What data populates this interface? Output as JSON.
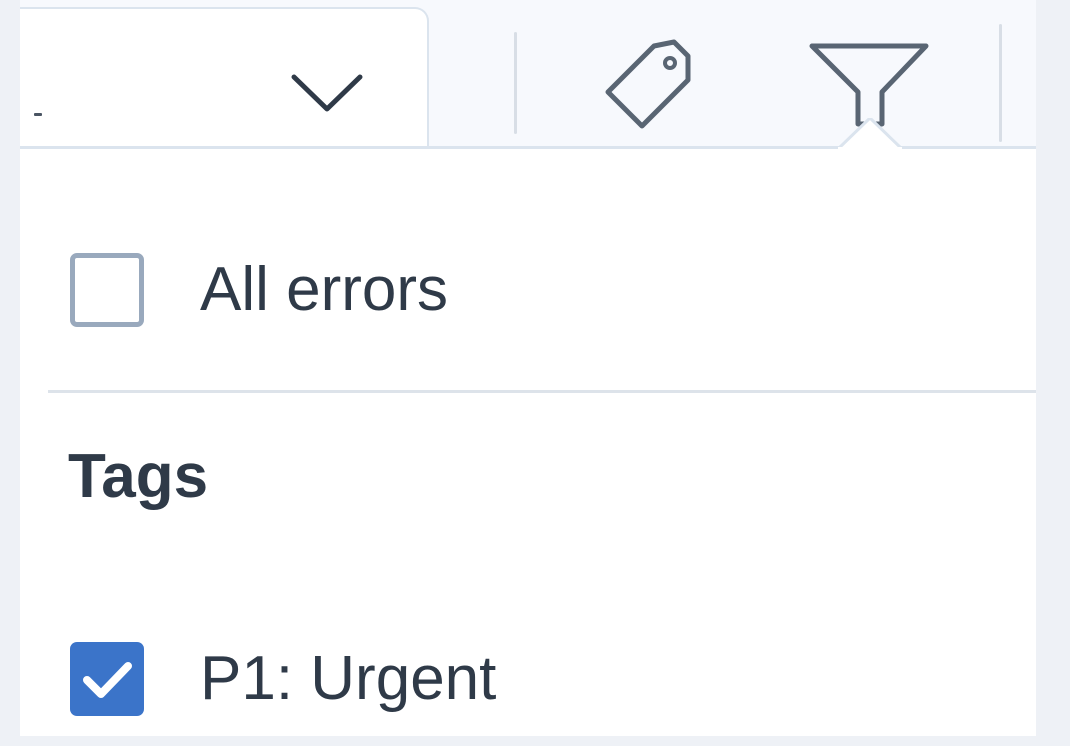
{
  "toolbar": {
    "select_value": "",
    "select_icon": "chevron-down-icon",
    "tag_icon": "tag-icon",
    "filter_icon": "filter-icon"
  },
  "filter_panel": {
    "all_errors": {
      "label": "All errors",
      "checked": false
    },
    "tags_heading": "Tags",
    "tags": [
      {
        "label": "P1: Urgent",
        "checked": true
      }
    ]
  },
  "colors": {
    "checkbox_checked": "#3b74c9",
    "checkbox_border": "#99a9bd",
    "text": "#2f3a48",
    "icon_stroke": "#596573",
    "toolbar_bg": "#f7f9fd"
  }
}
